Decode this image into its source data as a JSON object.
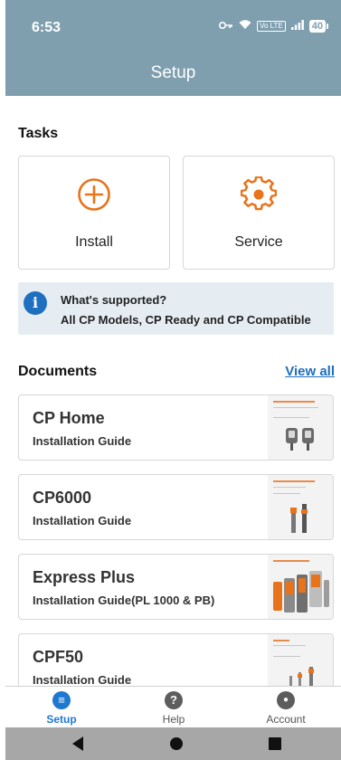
{
  "status_bar": {
    "time": "6:53",
    "lte_label": "Vo LTE",
    "battery": "40"
  },
  "header": {
    "title": "Setup"
  },
  "tasks": {
    "heading": "Tasks",
    "items": [
      {
        "label": "Install",
        "icon": "plus-circle-icon"
      },
      {
        "label": "Service",
        "icon": "gear-icon"
      }
    ],
    "accent_color": "#e8731a"
  },
  "info": {
    "title": "What's supported?",
    "text": "All CP Models, CP Ready and CP Compatible",
    "icon_glyph": "i"
  },
  "documents": {
    "heading": "Documents",
    "view_all": "View all",
    "items": [
      {
        "title": "CP Home",
        "subtitle": "Installation Guide"
      },
      {
        "title": "CP6000",
        "subtitle": "Installation Guide"
      },
      {
        "title": "Express Plus",
        "subtitle": "Installation Guide(PL 1000 & PB)"
      },
      {
        "title": "CPF50",
        "subtitle": "Installation Guide"
      }
    ]
  },
  "bottom_nav": {
    "items": [
      {
        "label": "Setup",
        "icon": "list-icon",
        "glyph": "≡",
        "active": true
      },
      {
        "label": "Help",
        "icon": "help-icon",
        "glyph": "?",
        "active": false
      },
      {
        "label": "Account",
        "icon": "account-icon",
        "glyph": "●",
        "active": false
      }
    ]
  },
  "colors": {
    "header_bg": "#7f9faf",
    "link_blue": "#1e6fbf",
    "orange": "#e8731a"
  }
}
